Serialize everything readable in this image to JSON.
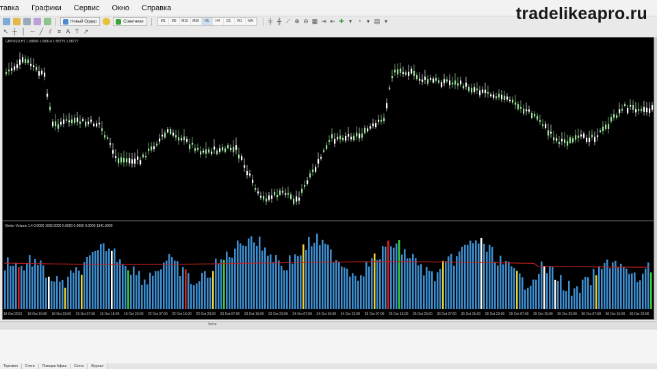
{
  "menu": {
    "items": [
      "тавка",
      "Графики",
      "Сервис",
      "Окно",
      "Справка"
    ]
  },
  "watermark": "tradelikeapro.ru",
  "toolbar": {
    "timeframes": [
      "M1",
      "M5",
      "M15",
      "M30",
      "H1",
      "H4",
      "D1",
      "W1",
      "MN"
    ],
    "active_timeframe": "H1",
    "new_order_label": "Новый Ордер",
    "experts_label": "Советники"
  },
  "chart": {
    "symbol_label": "GBPUSD,H1  1.58890 1.58914 1.58775 1.58777",
    "indicator_label": "Better Volume 1.4 0.0000 1032.0000 0.0000 0.0000 0.0000 1341.0000",
    "colors": {
      "background": "#000000",
      "candle_up": "#9be39b",
      "candle_down": "#ffffff",
      "vol_blue": "#3d8ed0",
      "vol_red": "#e0201a",
      "vol_white": "#ffffff",
      "vol_green": "#3ccf3c",
      "vol_yellow": "#e8d23a",
      "avg_line": "#c02020"
    },
    "time_labels": [
      "18 Oct 2012",
      "18 Oct 15:00",
      "18 Oct 23:00",
      "19 Oct 07:00",
      "19 Oct 15:00",
      "19 Oct 23:00",
      "22 Oct 07:00",
      "22 Oct 15:00",
      "22 Oct 23:00",
      "23 Oct 07:00",
      "23 Oct 15:00",
      "23 Oct 23:00",
      "24 Oct 07:00",
      "24 Oct 15:00",
      "24 Oct 23:00",
      "25 Oct 07:00",
      "25 Oct 15:00",
      "25 Oct 23:00",
      "26 Oct 07:00",
      "26 Oct 15:00",
      "26 Oct 23:00",
      "29 Oct 07:00",
      "29 Oct 15:00",
      "29 Oct 23:00",
      "30 Oct 07:00",
      "30 Oct 15:00",
      "30 Oct 23:00"
    ]
  },
  "terminal": {
    "title": "Тесте",
    "tabs": [
      "Торговля",
      "Счета",
      "Позиции Афиш",
      "Счета",
      "Журнал"
    ]
  }
}
